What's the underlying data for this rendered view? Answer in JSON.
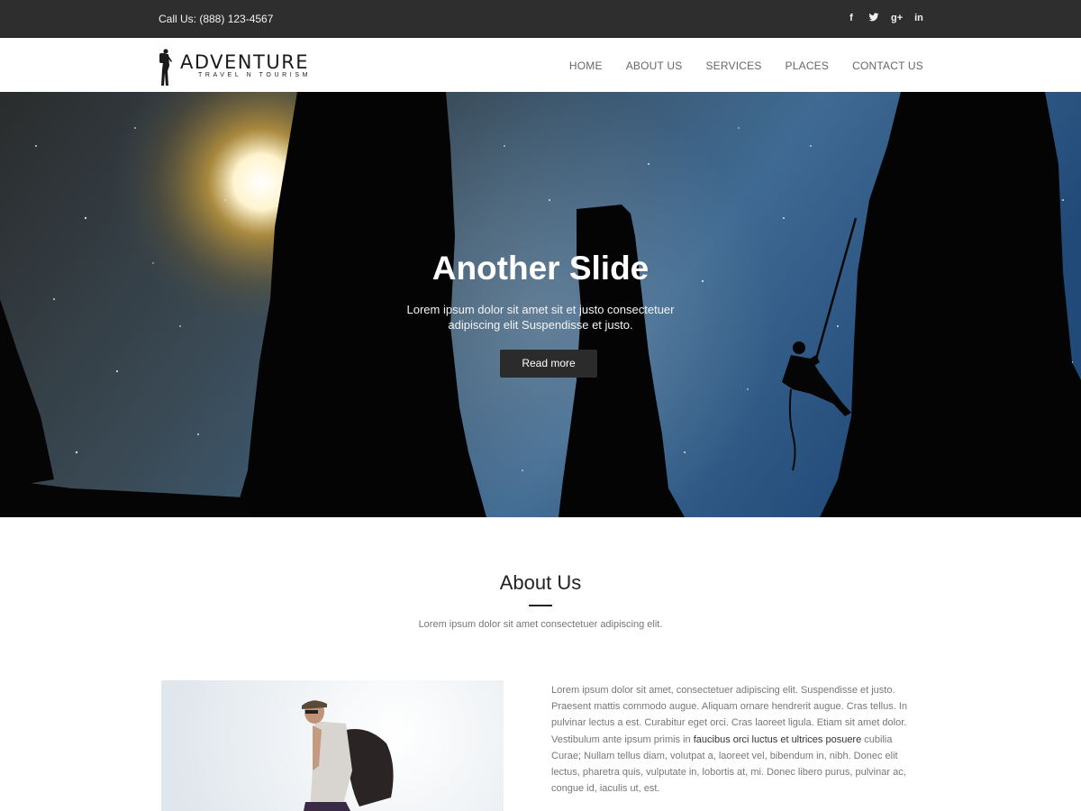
{
  "topbar": {
    "phone": "Call Us: (888) 123-4567",
    "social": [
      {
        "icon": "facebook-icon",
        "glyph": "f"
      },
      {
        "icon": "twitter-icon",
        "glyph": "t"
      },
      {
        "icon": "google-plus-icon",
        "glyph": "g+"
      },
      {
        "icon": "linkedin-icon",
        "glyph": "in"
      }
    ]
  },
  "header": {
    "logo": {
      "brand": "ADVENTURE",
      "tagline": "TRAVEL N TOURISM"
    },
    "nav": [
      "HOME",
      "ABOUT US",
      "SERVICES",
      "PLACES",
      "CONTACT US"
    ]
  },
  "hero": {
    "title": "Another Slide",
    "text": "Lorem ipsum dolor sit amet sit et justo consectetuer adipiscing elit Suspendisse et justo.",
    "button": "Read more"
  },
  "about": {
    "title": "About Us",
    "subtitle": "Lorem ipsum dolor sit amet consectetuer adipiscing elit.",
    "paragraph_start": "Lorem ipsum dolor sit amet, consectetuer adipiscing elit. Suspendisse et justo. Praesent mattis commodo augue. Aliquam ornare hendrerit augue. Cras tellus. In pulvinar lectus a est. Curabitur eget orci. Cras laoreet ligula. Etiam sit amet dolor. Vestibulum ante ipsum primis in ",
    "paragraph_highlight": "faucibus orci luctus et ultrices posuere",
    "paragraph_end": " cubilia Curae; Nullam tellus diam, volutpat a, laoreet vel, bibendum in, nibh. Donec elit lectus, pharetra quis, vulputate in, lobortis at, mi. Donec libero purus, pulvinar ac, congue id, iaculis ut, est."
  },
  "colors": {
    "topbar_bg": "#2e2e2e",
    "button_bg": "#2b2b2b",
    "nav_text": "#666666",
    "body_text": "#777777"
  }
}
